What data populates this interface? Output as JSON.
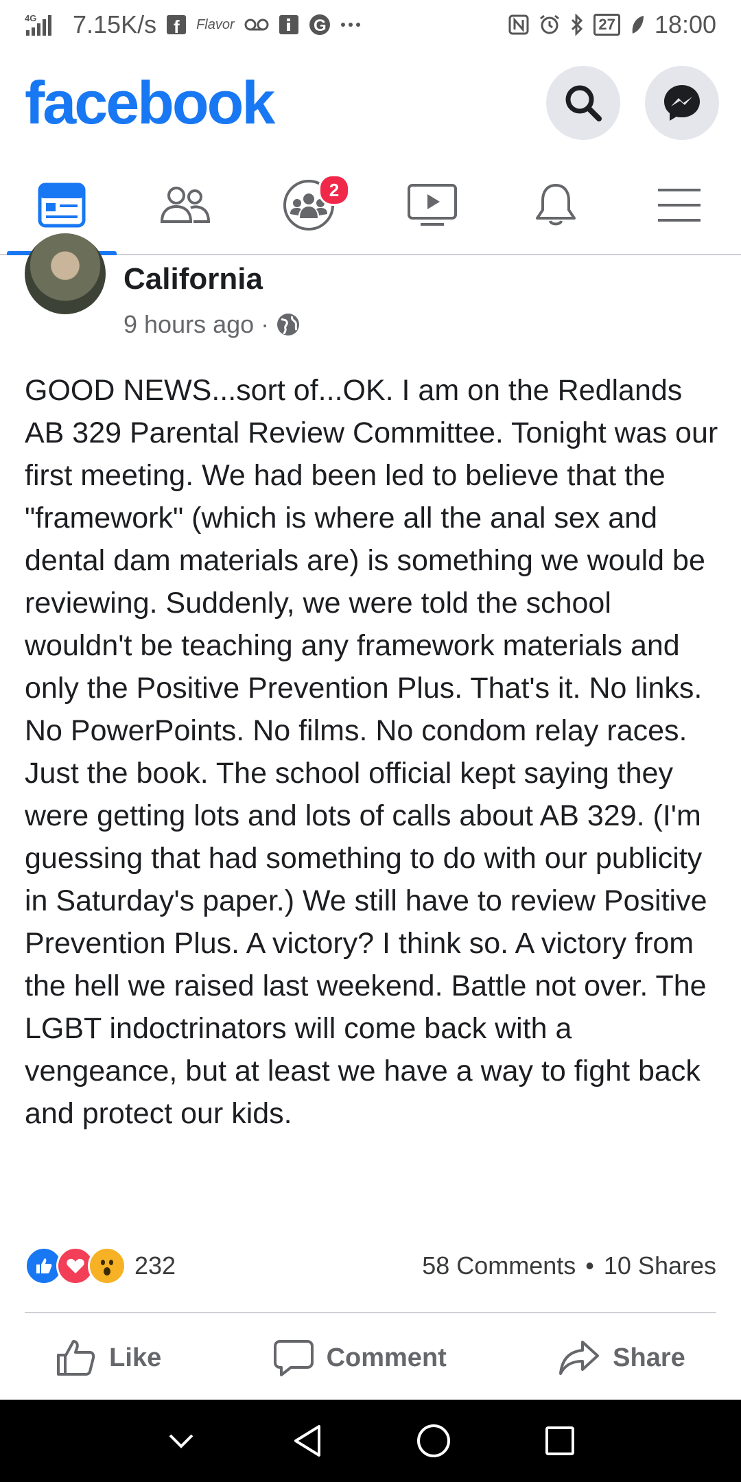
{
  "status_bar": {
    "network": "4G",
    "speed": "7.15K/s",
    "notif_icons": [
      "facebook-icon",
      "flavor-icon",
      "voicemail-icon",
      "info-icon",
      "google-icon",
      "more-icon"
    ],
    "flavor_label": "Flavor",
    "battery": "27",
    "time": "18:00"
  },
  "header": {
    "logo": "facebook",
    "search_icon": "search-icon",
    "messenger_icon": "messenger-icon"
  },
  "nav": {
    "tabs": [
      {
        "name": "tab-news-feed",
        "icon": "news-feed-icon",
        "active": true
      },
      {
        "name": "tab-friends",
        "icon": "friends-icon",
        "active": false
      },
      {
        "name": "tab-groups",
        "icon": "groups-icon",
        "active": false,
        "badge": "2"
      },
      {
        "name": "tab-watch",
        "icon": "watch-icon",
        "active": false
      },
      {
        "name": "tab-notifications",
        "icon": "bell-icon",
        "active": false
      },
      {
        "name": "tab-menu",
        "icon": "menu-icon",
        "active": false
      }
    ],
    "accent": "#1877f2"
  },
  "post": {
    "location": "California",
    "time": "9 hours ago",
    "separator": "·",
    "text": "GOOD NEWS...sort of...OK. I am on the Redlands AB 329 Parental Review Committee. Tonight was our first meeting. We had been led to believe that the \"framework\" (which is where all the anal sex and dental dam materials are) is something we would be reviewing. Suddenly, we were told the school wouldn't be teaching any framework materials and only the Positive Prevention Plus. That's it. No links. No PowerPoints. No films. No condom relay races. Just the book. The school official kept saying they were getting lots and lots of calls about AB 329. (I'm guessing that had something to do with our publicity in Saturday's paper.) We still have to review Positive Prevention Plus. A victory? I think so. A victory from the hell we raised last weekend. Battle not over. The LGBT indoctrinators will come back with a vengeance, but at least we have a way to fight back and protect our kids.",
    "reaction_count": "232",
    "comments": "58 Comments",
    "dot": "•",
    "shares": "10 Shares"
  },
  "actions": {
    "like": "Like",
    "comment": "Comment",
    "share": "Share"
  }
}
